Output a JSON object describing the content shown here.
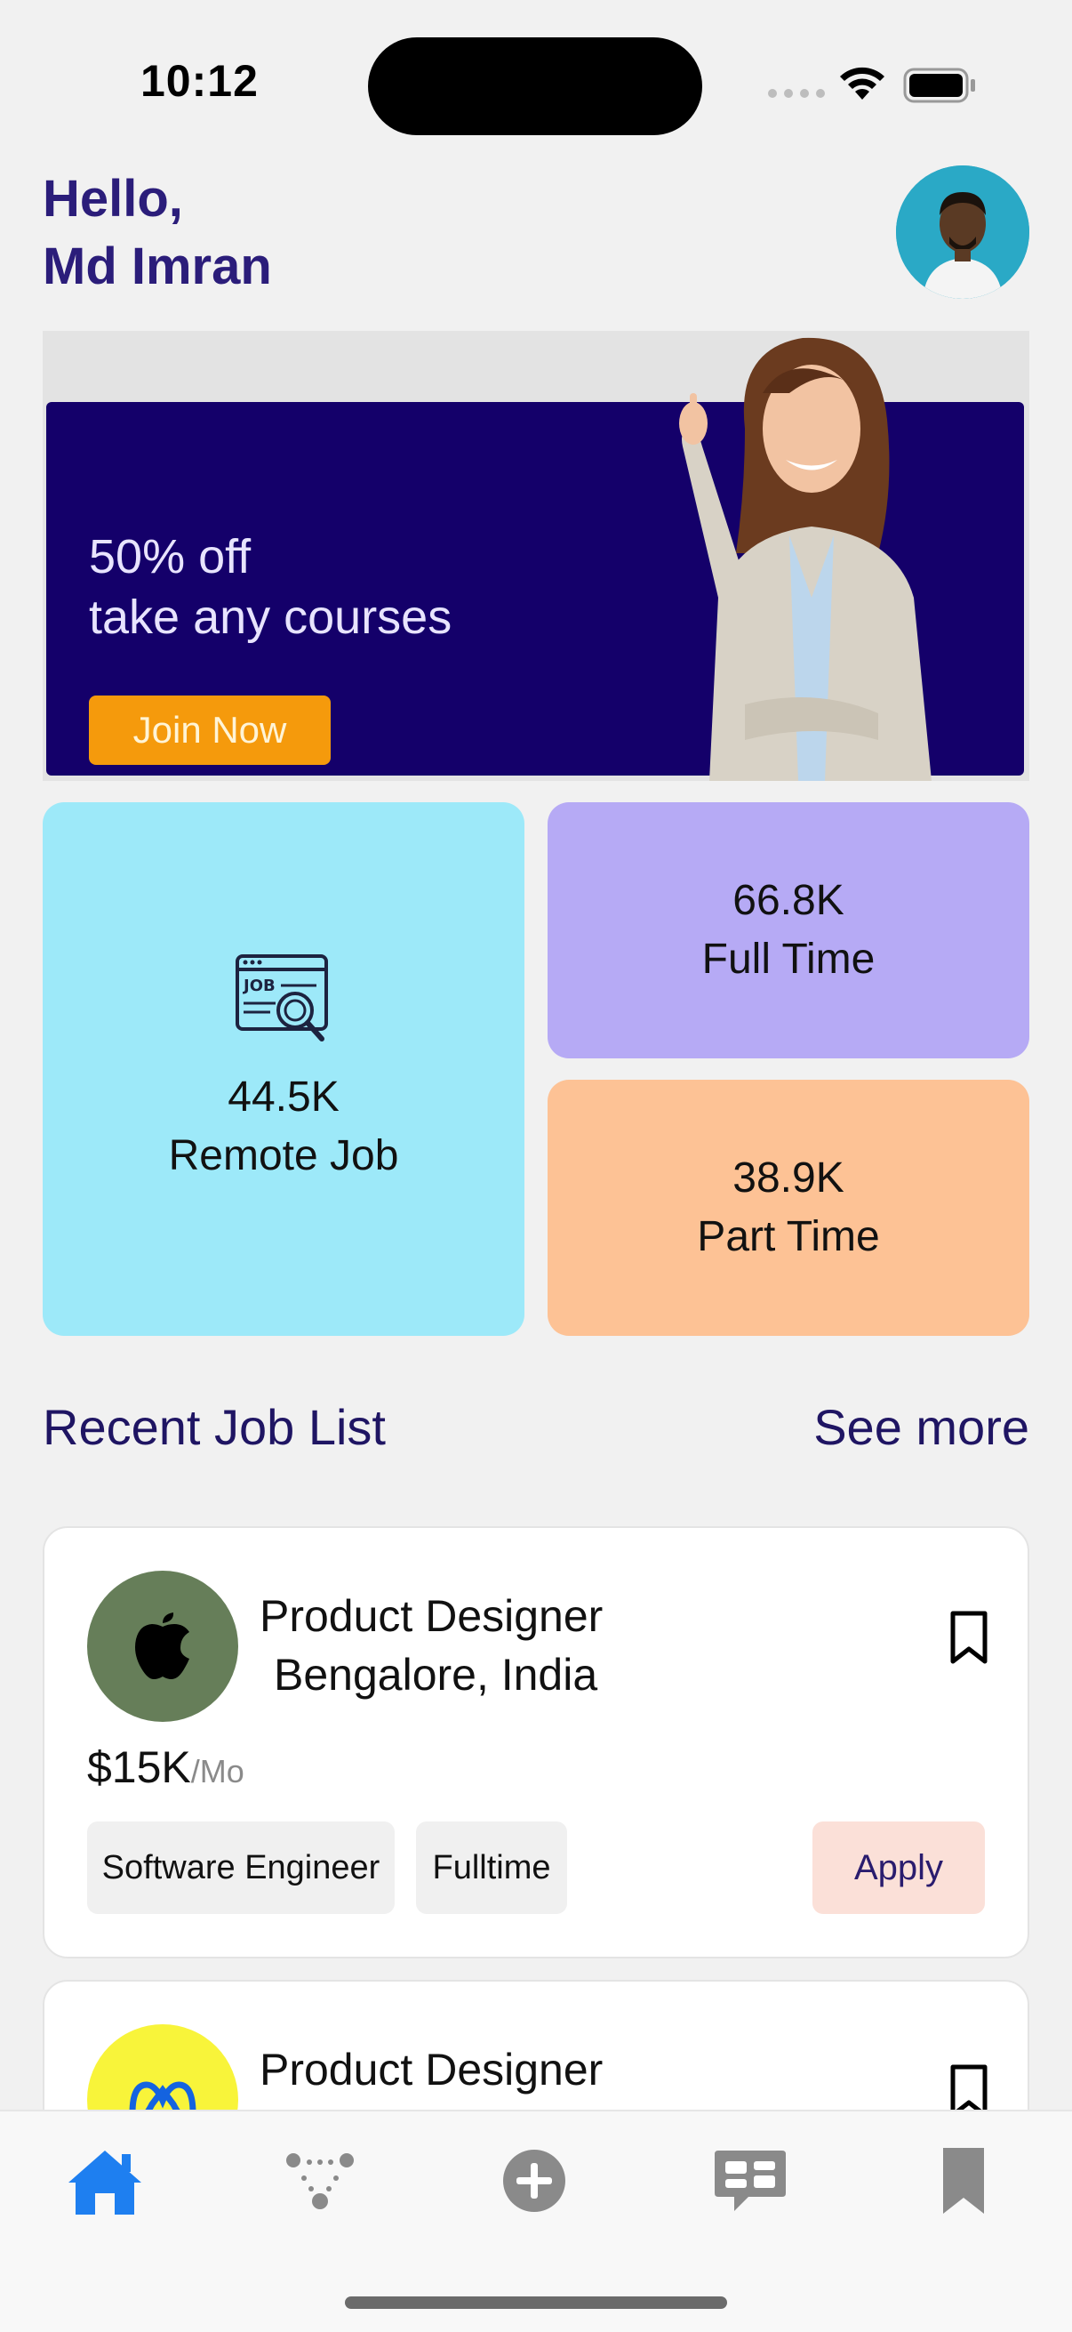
{
  "status_bar": {
    "time": "10:12"
  },
  "header": {
    "greeting_line1": "Hello,",
    "greeting_line2": "Md Imran"
  },
  "banner": {
    "line1": "50% off",
    "line2": "take any courses",
    "cta_label": "Join Now"
  },
  "categories": [
    {
      "count": "44.5K",
      "label": "Remote Job",
      "icon": "job-search-icon"
    },
    {
      "count": "66.8K",
      "label": "Full Time"
    },
    {
      "count": "38.9K",
      "label": "Part Time"
    }
  ],
  "recent_jobs": {
    "title": "Recent Job List",
    "see_more": "See more",
    "items": [
      {
        "title": "Product Designer",
        "location": "Bengalore, India",
        "salary": "$15K",
        "period": "/Mo",
        "tags": [
          "Software Engineer",
          "Fulltime"
        ],
        "apply_label": "Apply",
        "logo": "apple-logo-icon"
      },
      {
        "title": "Product Designer",
        "logo": "meta-logo-icon"
      }
    ]
  },
  "tab_bar": {
    "items": [
      "home-icon",
      "network-icon",
      "add-icon",
      "messages-icon",
      "bookmark-icon"
    ],
    "active": "home-icon"
  },
  "colors": {
    "primary_text": "#2b1d7a",
    "active_tab": "#1e7ff0",
    "banner_bg": "#14006a",
    "join_button": "#f59a0c",
    "remote_card": "#9de9f9",
    "fulltime_card": "#b6aaf5",
    "parttime_card": "#fdc295",
    "apply_button": "#fbe0d8"
  }
}
